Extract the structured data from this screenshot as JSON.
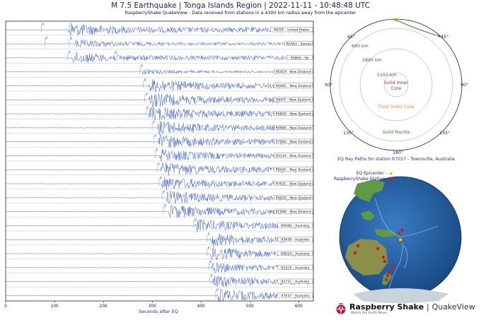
{
  "header": {
    "title": "M 7.5 Earthquake | Tonga Islands Region | 2022-11-11 - 10:48:48 UTC",
    "subtitle": "RaspberryShake QuakeView - Data received from stations in a 4300 km radius away from the epicenter"
  },
  "chart_data": [
    {
      "type": "line",
      "xlabel": "Seconds after EQ",
      "xlim": [
        0,
        630
      ],
      "xticks": [
        0,
        100,
        200,
        300,
        400,
        500,
        600
      ],
      "trace_color": "#3a5fd8",
      "p_marker_color": "#3a5fd8",
      "s_marker_color": "#2e8b2e",
      "series": [
        {
          "name": "R870F - United States",
          "p_arrival": 73,
          "s_arrival": 130,
          "onset": 125,
          "amp": 0.9
        },
        {
          "name": "RAA63 - Samoa",
          "p_arrival": 80,
          "s_arrival": 130,
          "onset": 140,
          "amp": 0.55
        },
        {
          "name": "R5B60 - Fiji",
          "p_arrival": 127,
          "s_arrival": 222,
          "onset": 133,
          "amp": 0.75
        },
        {
          "name": "RE4C9 - New Zealand",
          "p_arrival": 275,
          "s_arrival": 0,
          "onset": 275,
          "amp": 0.35
        },
        {
          "name": "RAA8C - New Zealand",
          "p_arrival": 282,
          "s_arrival": 0,
          "onset": 292,
          "amp": 0.9
        },
        {
          "name": "R6EFF - New Zealand",
          "p_arrival": 285,
          "s_arrival": 0,
          "onset": 292,
          "amp": 0.95
        },
        {
          "name": "R685D - New Zealand",
          "p_arrival": 287,
          "s_arrival": 0,
          "onset": 292,
          "amp": 0.95
        },
        {
          "name": "R99DE - New Zealand",
          "p_arrival": 300,
          "s_arrival": 0,
          "onset": 310,
          "amp": 0.9
        },
        {
          "name": "R7D82 - New Zealand",
          "p_arrival": 303,
          "s_arrival": 0,
          "onset": 312,
          "amp": 0.9
        },
        {
          "name": "R411A - New Zealand",
          "p_arrival": 306,
          "s_arrival": 0,
          "onset": 314,
          "amp": 0.8
        },
        {
          "name": "R8A0C - New Zealand",
          "p_arrival": 310,
          "s_arrival": 0,
          "onset": 316,
          "amp": 0.95
        },
        {
          "name": "R761C - New Zealand",
          "p_arrival": 314,
          "s_arrival": 0,
          "onset": 318,
          "amp": 0.9
        },
        {
          "name": "R4D20 - New Zealand",
          "p_arrival": 320,
          "s_arrival": 0,
          "onset": 328,
          "amp": 0.9
        },
        {
          "name": "RCD80 - New Zealand",
          "p_arrival": 323,
          "s_arrival": 0,
          "onset": 333,
          "amp": 0.9
        },
        {
          "name": "R9A9D - Australia",
          "p_arrival": 385,
          "s_arrival": 0,
          "onset": 387,
          "amp": 0.85
        },
        {
          "name": "R365B - Australia",
          "p_arrival": 412,
          "s_arrival": 0,
          "onset": 418,
          "amp": 0.85
        },
        {
          "name": "R6D2A - Australia",
          "p_arrival": 412,
          "s_arrival": 0,
          "onset": 418,
          "amp": 0.85
        },
        {
          "name": "R21C0 - Australia",
          "p_arrival": 416,
          "s_arrival": 0,
          "onset": 420,
          "amp": 0.7
        },
        {
          "name": "R571C - Australia",
          "p_arrival": 418,
          "s_arrival": 0,
          "onset": 422,
          "amp": 0.85
        },
        {
          "name": "R7037 - Australia",
          "p_arrival": 430,
          "s_arrival": 0,
          "onset": 432,
          "amp": 0.85
        }
      ]
    }
  ],
  "ray_path_diagram": {
    "caption": "EQ Ray Paths for station R7037 - Townsville, Australia",
    "angle_labels": [
      "45°",
      "45°",
      "90°",
      "90°",
      "135°",
      "135°",
      "180°"
    ],
    "depth_labels": [
      "660 km",
      "2890 km",
      "5150 km"
    ],
    "layer_labels": [
      "Solid Inner",
      "Core",
      "Fluid Outer Core",
      "Solid Mantle"
    ],
    "colors": {
      "inner_core": "#cc2222",
      "outer_core": "#e69020",
      "mantle": "#2f8f2f",
      "ray": "#2f8f2f",
      "epicenter_star": "#d4b100",
      "station": "#cc1a1a"
    }
  },
  "globe": {
    "legend": {
      "epicenter": "EQ Epicenter -",
      "station": "RaspberryShake Station -"
    },
    "colors": {
      "ocean": "#1f5fa8",
      "land": "#5f9a44",
      "station": "#d11a1a",
      "epicenter": "#f2d20a"
    }
  },
  "brand": {
    "name": "Raspberry Shake",
    "separator": "|",
    "product": "QuakeView",
    "tagline": "Watch the Earth Move"
  }
}
